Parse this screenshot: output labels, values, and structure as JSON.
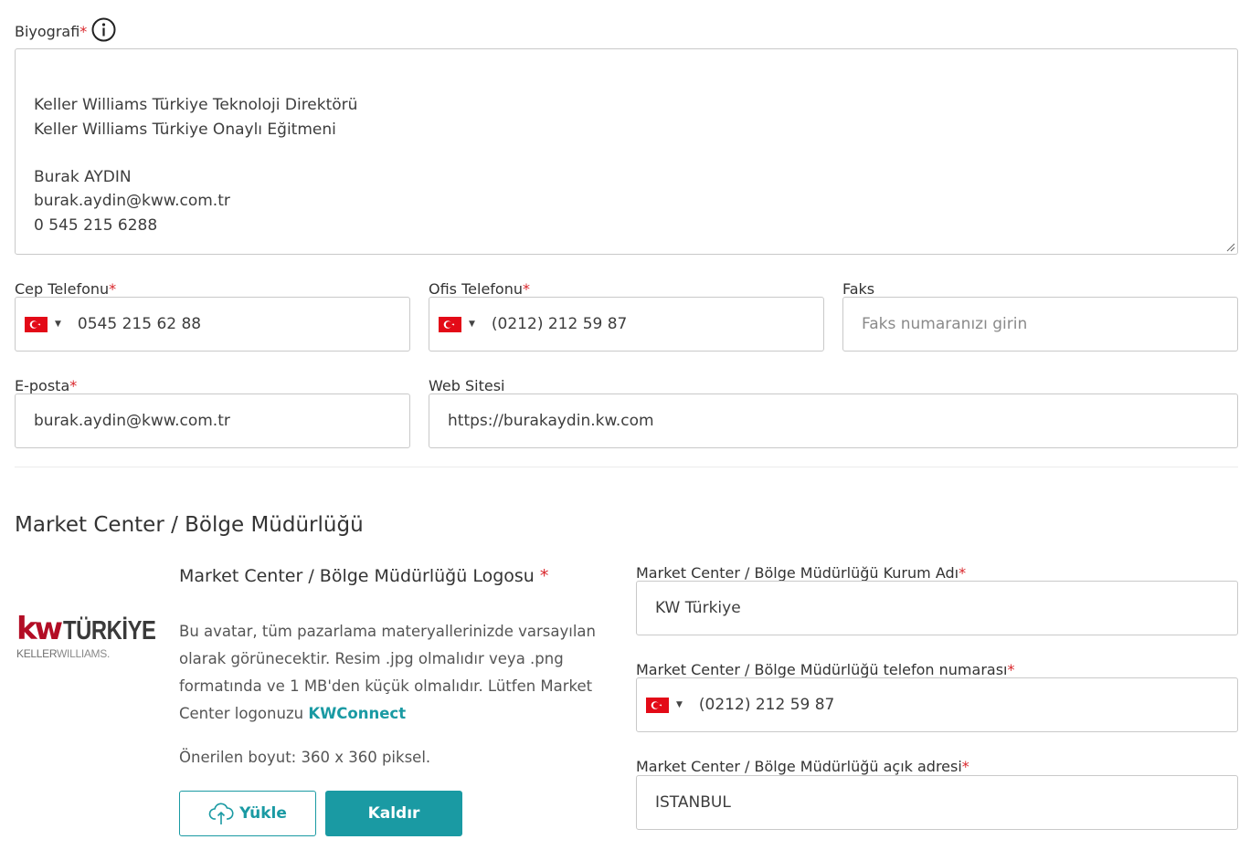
{
  "bio": {
    "label": "Biyografi",
    "required_mark": "*",
    "text": "Keller Williams Türkiye Teknoloji Direktörü\nKeller Williams Türkiye Onaylı Eğitmeni\n\nBurak AYDIN\nburak.aydin@kww.com.tr\n0 545 215 6288"
  },
  "mobile": {
    "label": "Cep Telefonu",
    "required_mark": "*",
    "value": "0545 215 62 88",
    "country_flag": "turkey-flag-icon"
  },
  "office": {
    "label": "Ofis Telefonu",
    "required_mark": "*",
    "value": "(0212) 212 59 87",
    "country_flag": "turkey-flag-icon"
  },
  "fax": {
    "label": "Faks",
    "placeholder": "Faks numaranızı girin"
  },
  "email": {
    "label": "E-posta",
    "required_mark": "*",
    "value": "burak.aydin@kww.com.tr"
  },
  "website": {
    "label": "Web Sitesi",
    "value": "https://burakaydin.kw.com"
  },
  "market_center": {
    "section_title": "Market Center / Bölge Müdürlüğü",
    "logo": {
      "brand_kw": "kw",
      "brand_name": "TÜRKİYE",
      "brand_sub_bold": "KELLER",
      "brand_sub": "WILLIAMS.",
      "heading": "Market Center / Bölge Müdürlüğü Logosu",
      "required_mark": "*",
      "description": "Bu avatar, tüm pazarlama materyallerinizde varsayılan olarak görünecektir. Resim .jpg olmalıdır veya .png formatında ve 1 MB'den küçük olmalıdır. Lütfen Market Center logonuzu ",
      "link_text": "KWConnect",
      "size_note": "Önerilen boyut: 360 x 360 piksel.",
      "upload_label": "Yükle",
      "remove_label": "Kaldır"
    },
    "org_name": {
      "label": "Market Center / Bölge Müdürlüğü Kurum Adı",
      "required_mark": "*",
      "value": "KW Türkiye"
    },
    "phone": {
      "label": "Market Center / Bölge Müdürlüğü telefon numarası",
      "required_mark": "*",
      "value": "(0212) 212 59 87",
      "country_flag": "turkey-flag-icon"
    },
    "address": {
      "label": "Market Center / Bölge Müdürlüğü açık adresi",
      "required_mark": "*",
      "value": "ISTANBUL"
    }
  },
  "colors": {
    "accent": "#1a9aa3",
    "required": "#d9262b",
    "border": "#c9c9c9",
    "brand_red": "#b30d25"
  }
}
